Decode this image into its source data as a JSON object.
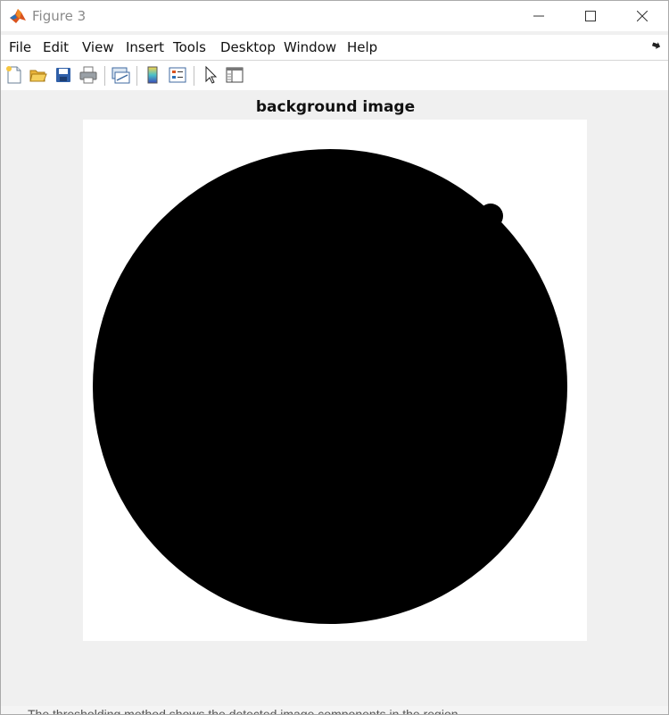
{
  "window": {
    "title": "Figure 3"
  },
  "menubar": {
    "items": [
      "File",
      "Edit",
      "View",
      "Insert",
      "Tools",
      "Desktop",
      "Window",
      "Help"
    ]
  },
  "toolbar": {
    "buttons": [
      {
        "name": "new-figure-icon"
      },
      {
        "name": "open-file-icon"
      },
      {
        "name": "save-icon"
      },
      {
        "name": "print-icon"
      },
      {
        "name": "link-plot-icon"
      },
      {
        "name": "insert-colorbar-icon"
      },
      {
        "name": "insert-legend-icon"
      },
      {
        "name": "edit-plot-arrow-icon"
      },
      {
        "name": "property-inspector-icon"
      }
    ]
  },
  "plot": {
    "title": "background image",
    "image_colors": {
      "background": "#ffffff",
      "foreground": "#000000"
    }
  },
  "colors": {
    "window_bg": "#f0f0f0",
    "title_text": "#8a8a8a"
  },
  "bottom_strip": {
    "text": "The thresholding method shows the detected image components in the region"
  }
}
